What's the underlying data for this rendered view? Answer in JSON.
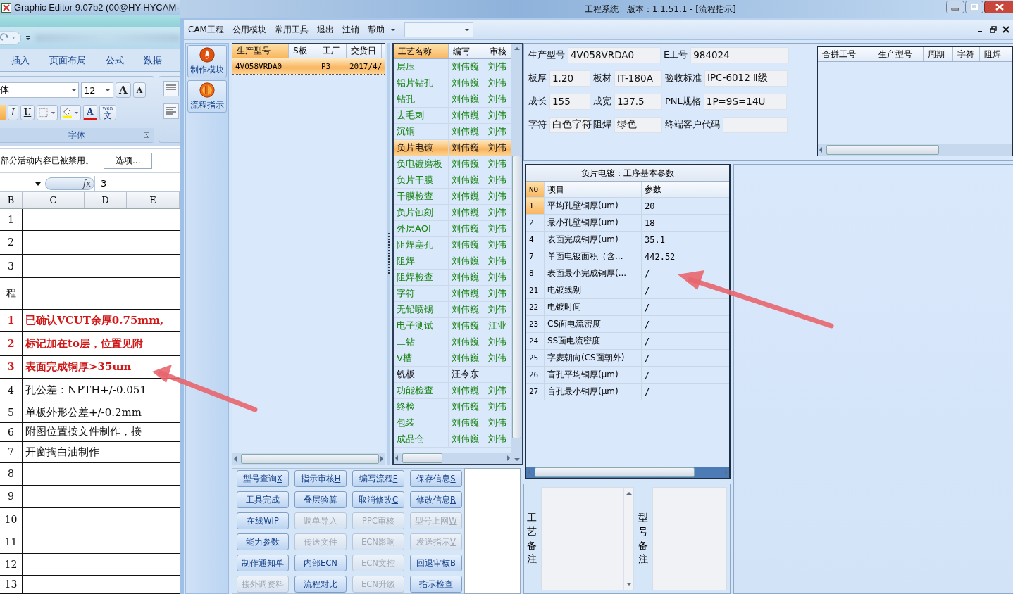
{
  "excel": {
    "title": "Graphic Editor 9.07b2 (00@HY-HYCAM-",
    "ribbon_tabs": [
      "插入",
      "页面布局",
      "公式",
      "数据"
    ],
    "font_name": "体",
    "font_size": "12",
    "size_buttons": [
      "A",
      "A"
    ],
    "format_buttons": [
      "I",
      "U"
    ],
    "font_color_button": "A",
    "phonetic_button": {
      "pinyin": "wén",
      "char": "文"
    },
    "group_label": "字体",
    "message": "部分活动内容已被禁用。",
    "message_button": "选项...",
    "fx": "fx",
    "formula_value": "3",
    "columns": [
      "B",
      "C",
      "D",
      "E"
    ],
    "rows": [
      {
        "number": "1",
        "text": "",
        "flagged": false
      },
      {
        "number": "2",
        "text": "",
        "flagged": false
      },
      {
        "number": "3",
        "text": "",
        "flagged": false
      },
      {
        "number": "程",
        "text": "",
        "flagged": false
      },
      {
        "number": "1",
        "text": "已确认VCUT余厚0.75mm,",
        "flagged": true
      },
      {
        "number": "2",
        "text": "标记加在to层，位置见附",
        "flagged": true
      },
      {
        "number": "3",
        "text": "表面完成铜厚>35um",
        "flagged": true
      },
      {
        "number": "4",
        "text": "孔公差：NPTH+/-0.051",
        "flagged": false
      },
      {
        "number": "5",
        "text": "单板外形公差+/-0.2mm",
        "flagged": false
      },
      {
        "number": "6",
        "text": "附图位置按文件制作，接",
        "flagged": false
      },
      {
        "number": "7",
        "text": "开窗掏白油制作",
        "flagged": false
      },
      {
        "number": "8",
        "text": "",
        "flagged": false
      },
      {
        "number": "9",
        "text": "",
        "flagged": false
      },
      {
        "number": "10",
        "text": "",
        "flagged": false
      },
      {
        "number": "11",
        "text": "",
        "flagged": false
      },
      {
        "number": "12",
        "text": "",
        "flagged": false
      },
      {
        "number": "13",
        "text": "",
        "flagged": false
      }
    ]
  },
  "cam": {
    "title": "工程系统   版本：1.1.51.1 - [流程指示]",
    "menu": [
      "CAM工程",
      "公用模块",
      "常用工具",
      "退出",
      "注销",
      "帮助"
    ],
    "nav": [
      {
        "label": "制作模块",
        "kind": "flame"
      },
      {
        "label": "流程指示",
        "kind": "globe"
      }
    ],
    "products": {
      "columns": [
        {
          "label": "生产型号",
          "sorted": true
        },
        {
          "label": "S板",
          "sorted": false
        },
        {
          "label": "工厂",
          "sorted": false
        },
        {
          "label": "交货日",
          "sorted": false
        }
      ],
      "rows": [
        {
          "cells": [
            "4V058VRDA0",
            "",
            "P3",
            "2017/4/"
          ],
          "selected": true
        }
      ]
    },
    "process": {
      "columns": [
        {
          "label": "工艺名称",
          "sorted": true
        },
        {
          "label": "编写",
          "sorted": false
        },
        {
          "label": "审核",
          "sorted": false
        }
      ],
      "rows": [
        {
          "name": "层压",
          "writer": "刘伟巍",
          "reviewer": "刘伟",
          "approved": true,
          "selected": false
        },
        {
          "name": "铝片钻孔",
          "writer": "刘伟巍",
          "reviewer": "刘伟",
          "approved": true,
          "selected": false
        },
        {
          "name": "钻孔",
          "writer": "刘伟巍",
          "reviewer": "刘伟",
          "approved": true,
          "selected": false
        },
        {
          "name": "去毛刺",
          "writer": "刘伟巍",
          "reviewer": "刘伟",
          "approved": true,
          "selected": false
        },
        {
          "name": "沉铜",
          "writer": "刘伟巍",
          "reviewer": "刘伟",
          "approved": true,
          "selected": false
        },
        {
          "name": "负片电镀",
          "writer": "刘伟巍",
          "reviewer": "刘伟",
          "approved": true,
          "selected": true
        },
        {
          "name": "负电镀磨板",
          "writer": "刘伟巍",
          "reviewer": "刘伟",
          "approved": true,
          "selected": false
        },
        {
          "name": "负片干膜",
          "writer": "刘伟巍",
          "reviewer": "刘伟",
          "approved": true,
          "selected": false
        },
        {
          "name": "干膜检查",
          "writer": "刘伟巍",
          "reviewer": "刘伟",
          "approved": true,
          "selected": false
        },
        {
          "name": "负片蚀刻",
          "writer": "刘伟巍",
          "reviewer": "刘伟",
          "approved": true,
          "selected": false
        },
        {
          "name": "外层AOI",
          "writer": "刘伟巍",
          "reviewer": "刘伟",
          "approved": true,
          "selected": false
        },
        {
          "name": "阻焊塞孔",
          "writer": "刘伟巍",
          "reviewer": "刘伟",
          "approved": true,
          "selected": false
        },
        {
          "name": "阻焊",
          "writer": "刘伟巍",
          "reviewer": "刘伟",
          "approved": true,
          "selected": false
        },
        {
          "name": "阻焊检查",
          "writer": "刘伟巍",
          "reviewer": "刘伟",
          "approved": true,
          "selected": false
        },
        {
          "name": "字符",
          "writer": "刘伟巍",
          "reviewer": "刘伟",
          "approved": true,
          "selected": false
        },
        {
          "name": "无铅喷锡",
          "writer": "刘伟巍",
          "reviewer": "刘伟",
          "approved": true,
          "selected": false
        },
        {
          "name": "电子测试",
          "writer": "刘伟巍",
          "reviewer": "江业",
          "approved": true,
          "selected": false
        },
        {
          "name": "二钻",
          "writer": "刘伟巍",
          "reviewer": "刘伟",
          "approved": true,
          "selected": false
        },
        {
          "name": "V槽",
          "writer": "刘伟巍",
          "reviewer": "刘伟",
          "approved": true,
          "selected": false
        },
        {
          "name": "铣板",
          "writer": "汪令东",
          "reviewer": "",
          "approved": false,
          "selected": false
        },
        {
          "name": "功能检查",
          "writer": "刘伟巍",
          "reviewer": "刘伟",
          "approved": true,
          "selected": false
        },
        {
          "name": "终检",
          "writer": "刘伟巍",
          "reviewer": "刘伟",
          "approved": true,
          "selected": false
        },
        {
          "name": "包装",
          "writer": "刘伟巍",
          "reviewer": "刘伟",
          "approved": true,
          "selected": false
        },
        {
          "name": "成品仓",
          "writer": "刘伟巍",
          "reviewer": "刘伟",
          "approved": true,
          "selected": false
        }
      ]
    },
    "buttons": [
      {
        "label": "型号查询",
        "key": "X",
        "disabled": false
      },
      {
        "label": "指示审核",
        "key": "H",
        "disabled": false
      },
      {
        "label": "编写流程",
        "key": "F",
        "disabled": false
      },
      {
        "label": "保存信息",
        "key": "S",
        "disabled": false
      },
      {
        "label": "工具完成",
        "disabled": false
      },
      {
        "label": "叠层验算",
        "disabled": false
      },
      {
        "label": "取消修改",
        "key": "C",
        "disabled": false
      },
      {
        "label": "修改信息",
        "key": "R",
        "disabled": false
      },
      {
        "label": "在线WIP",
        "disabled": false
      },
      {
        "label": "调单导入",
        "disabled": true
      },
      {
        "label": "PPC审核",
        "disabled": true
      },
      {
        "label": "型号上网",
        "key": "W",
        "disabled": true
      },
      {
        "label": "能力参数",
        "disabled": false
      },
      {
        "label": "传送文件",
        "disabled": true
      },
      {
        "label": "ECN影响",
        "disabled": true
      },
      {
        "label": "发送指示",
        "key": "V",
        "disabled": true
      },
      {
        "label": "制作通知单",
        "disabled": false
      },
      {
        "label": "内部ECN",
        "disabled": false
      },
      {
        "label": "ECN文控",
        "disabled": true
      },
      {
        "label": "回退审核",
        "key": "B",
        "disabled": false
      },
      {
        "label": "接外调资料",
        "disabled": true
      },
      {
        "label": "流程对比",
        "disabled": false
      },
      {
        "label": "ECN升级",
        "disabled": true
      },
      {
        "label": "指示检查",
        "disabled": false
      }
    ],
    "info": [
      [
        {
          "label": "生产型号",
          "value": "4V058VRDA0"
        },
        {
          "label": "E工号",
          "value": "984024"
        }
      ],
      [
        {
          "label": "板厚",
          "value": "1.20"
        },
        {
          "label": "板材",
          "value": "IT-180A"
        },
        {
          "label": "验收标准",
          "value": "IPC-6012 Ⅱ级"
        }
      ],
      [
        {
          "label": "成长",
          "value": "155"
        },
        {
          "label": "成宽",
          "value": "137.5"
        },
        {
          "label": "PNL规格",
          "value": "1P=9S=14U"
        }
      ],
      [
        {
          "label": "字符",
          "value": "白色字符"
        },
        {
          "label": "阻焊",
          "value": "绿色"
        },
        {
          "label": "终端客户代码"
        }
      ]
    ],
    "merge_table": {
      "columns": [
        "合拼工号",
        "生产型号",
        "周期",
        "字符",
        "阻焊"
      ]
    },
    "params": {
      "title": "负片电镀：工序基本参数",
      "columns": [
        "NO",
        "项目",
        "参数"
      ],
      "rows": [
        {
          "no": "1",
          "item": "平均孔壁铜厚(um)",
          "value": "20",
          "selected": true
        },
        {
          "no": "2",
          "item": "最小孔壁铜厚(um)",
          "value": "18",
          "selected": false
        },
        {
          "no": "4",
          "item": "表面完成铜厚(um)",
          "value": "35.1",
          "selected": false
        },
        {
          "no": "7",
          "item": "单面电镀面积（含...",
          "value": "442.52",
          "selected": false
        },
        {
          "no": "8",
          "item": "表面最小完成铜厚(...",
          "value": "/",
          "selected": false
        },
        {
          "no": "21",
          "item": "电镀线别",
          "value": "/",
          "selected": false
        },
        {
          "no": "22",
          "item": "电镀时间",
          "value": "/",
          "selected": false
        },
        {
          "no": "23",
          "item": "CS面电流密度",
          "value": "/",
          "selected": false
        },
        {
          "no": "24",
          "item": "SS面电流密度",
          "value": "/",
          "selected": false
        },
        {
          "no": "25",
          "item": "字麦朝向(CS面朝外)",
          "value": "/",
          "selected": false
        },
        {
          "no": "26",
          "item": "盲孔平均铜厚(μm)",
          "value": "/",
          "selected": false
        },
        {
          "no": "27",
          "item": "盲孔最小铜厚(μm)",
          "value": "/",
          "selected": false
        }
      ]
    },
    "remarks": [
      "工艺备注",
      "型号备注"
    ]
  }
}
